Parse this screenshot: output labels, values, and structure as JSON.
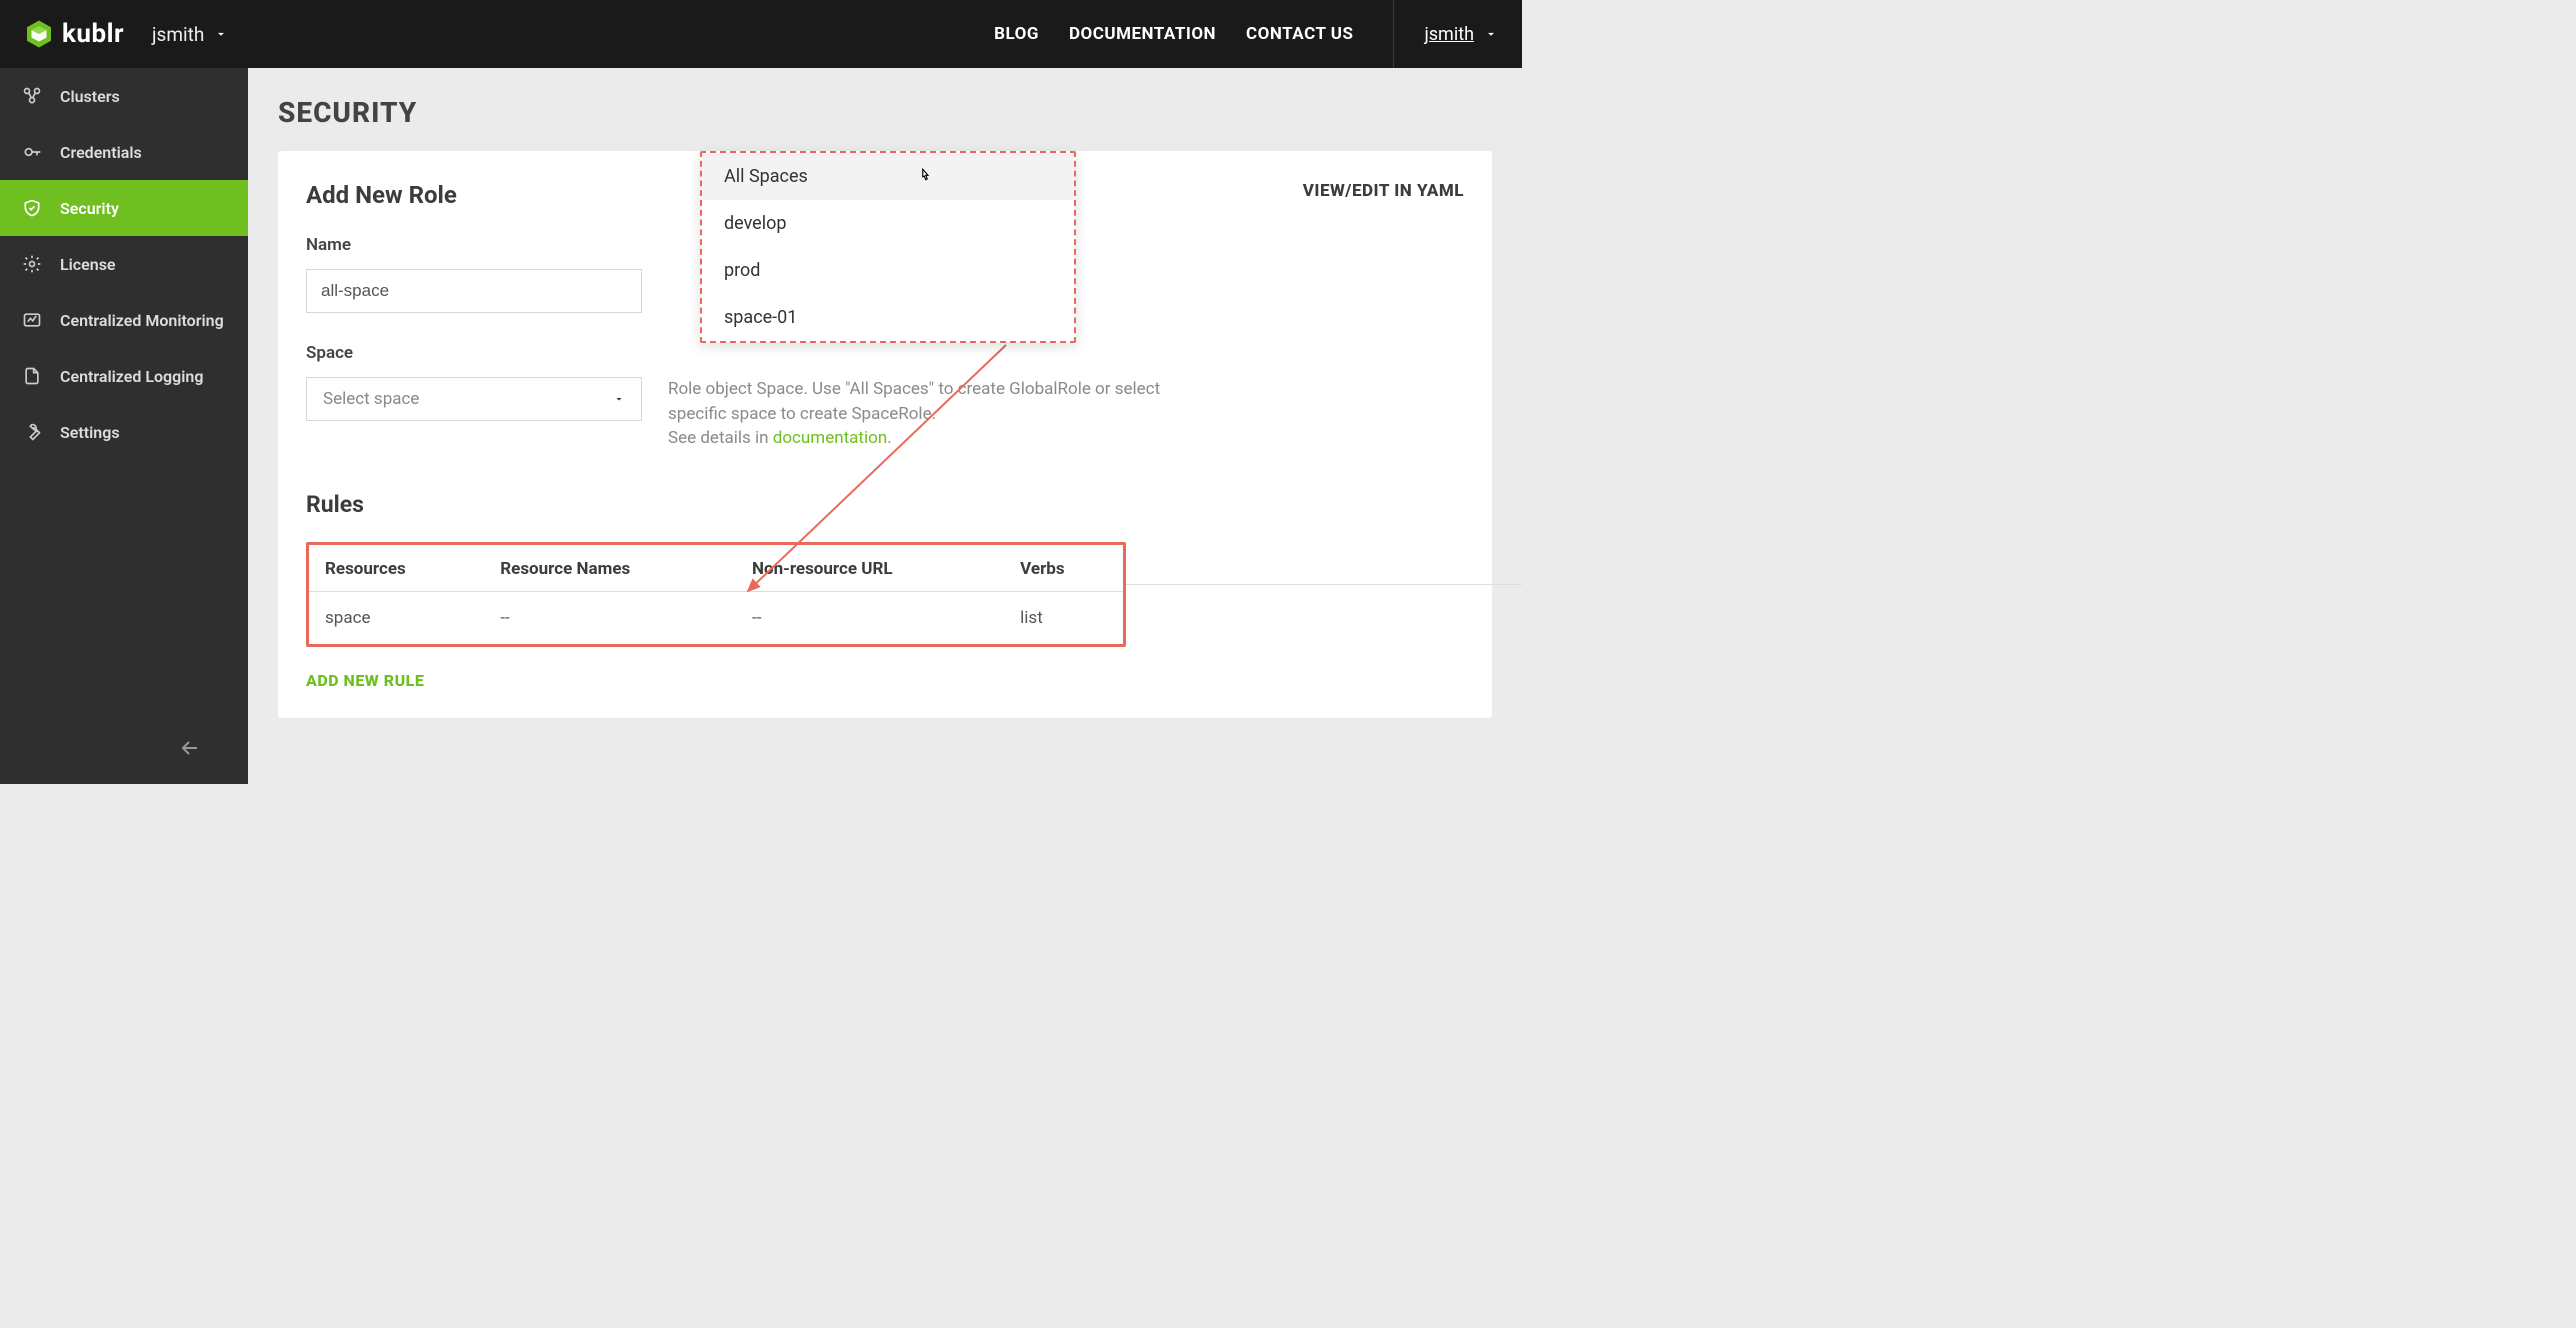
{
  "brand": "kublr",
  "space_switcher": {
    "current": "jsmith"
  },
  "topnav": {
    "blog": "BLOG",
    "documentation": "DOCUMENTATION",
    "contact": "CONTACT US",
    "user": "jsmith"
  },
  "sidebar": {
    "items": [
      {
        "label": "Clusters",
        "icon": "clusters"
      },
      {
        "label": "Credentials",
        "icon": "key"
      },
      {
        "label": "Security",
        "icon": "shield",
        "active": true
      },
      {
        "label": "License",
        "icon": "gear"
      },
      {
        "label": "Centralized Monitoring",
        "icon": "monitor"
      },
      {
        "label": "Centralized Logging",
        "icon": "file"
      },
      {
        "label": "Settings",
        "icon": "wrench"
      }
    ]
  },
  "page": {
    "title": "SECURITY",
    "card_title": "Add New Role",
    "yaml_link": "VIEW/EDIT IN YAML",
    "name_label": "Name",
    "name_value": "all-space",
    "space_label": "Space",
    "space_placeholder": "Select space",
    "help_text_1": "Role object Space. Use \"All Spaces\" to create GlobalRole or select specific space to create SpaceRole.",
    "help_text_2a": "See details in ",
    "help_link": "documentation",
    "help_text_2b": ".",
    "dropdown_options": [
      "All Spaces",
      "develop",
      "prod",
      "space-01"
    ],
    "rules_title": "Rules",
    "rules_columns": [
      "Resources",
      "Resource Names",
      "Non-resource URL",
      "Verbs"
    ],
    "rules_rows": [
      {
        "resources": "space",
        "resource_names": "--",
        "non_resource_url": "--",
        "verbs": "list"
      }
    ],
    "add_rule": "ADD NEW RULE"
  }
}
